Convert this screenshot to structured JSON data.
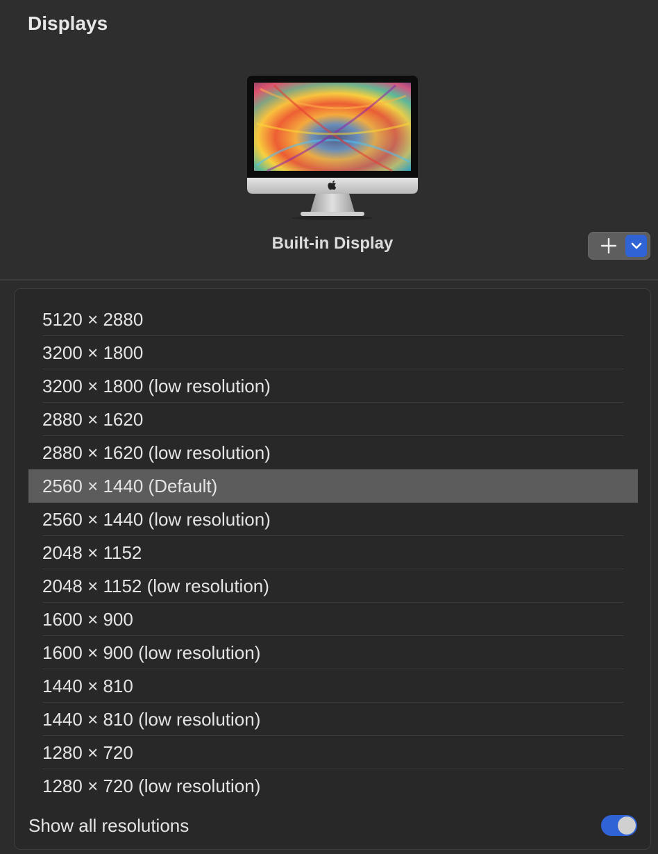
{
  "header": {
    "title": "Displays"
  },
  "display": {
    "name": "Built-in Display",
    "image_icon": "imac-icon"
  },
  "controls": {
    "add_icon": "plus-icon",
    "menu_icon": "chevron-down-icon",
    "accent_color": "#2f63d6"
  },
  "resolutions": {
    "items": [
      {
        "label": "5120 × 2880",
        "selected": false
      },
      {
        "label": "3200 × 1800",
        "selected": false
      },
      {
        "label": "3200 × 1800 (low resolution)",
        "selected": false
      },
      {
        "label": "2880 × 1620",
        "selected": false
      },
      {
        "label": "2880 × 1620 (low resolution)",
        "selected": false
      },
      {
        "label": "2560 × 1440 (Default)",
        "selected": true
      },
      {
        "label": "2560 × 1440 (low resolution)",
        "selected": false
      },
      {
        "label": "2048 × 1152",
        "selected": false
      },
      {
        "label": "2048 × 1152 (low resolution)",
        "selected": false
      },
      {
        "label": "1600 × 900",
        "selected": false
      },
      {
        "label": "1600 × 900 (low resolution)",
        "selected": false
      },
      {
        "label": "1440 × 810",
        "selected": false
      },
      {
        "label": "1440 × 810 (low resolution)",
        "selected": false
      },
      {
        "label": "1280 × 720",
        "selected": false
      },
      {
        "label": "1280 × 720 (low resolution)",
        "selected": false
      }
    ],
    "show_all_label": "Show all resolutions",
    "show_all_enabled": true
  }
}
